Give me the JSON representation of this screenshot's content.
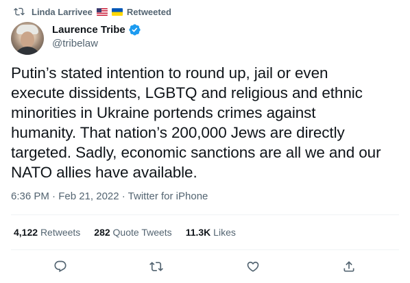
{
  "context": {
    "icon": "retweet-icon",
    "retweeter": "Linda Larrivee",
    "flags": [
      "flag-us",
      "flag-ukraine"
    ],
    "label": "Retweeted"
  },
  "author": {
    "display_name": "Laurence Tribe",
    "verified": true,
    "handle": "@tribelaw"
  },
  "tweet": {
    "text": "Putin’s stated intention to round up, jail or even\nexecute dissidents, LGBTQ and religious and ethnic\nminorities in Ukraine portends crimes against\nhumanity. That nation’s 200,000 Jews are directly\ntargeted. Sadly, economic sanctions are all we and our\nNATO allies have available.",
    "time": "6:36 PM · Feb 21, 2022 · Twitter for iPhone"
  },
  "stats": {
    "retweets": {
      "count": "4,122",
      "label": "Retweets"
    },
    "quote_tweets": {
      "count": "282",
      "label": "Quote Tweets"
    },
    "likes": {
      "count": "11.3K",
      "label": "Likes"
    }
  },
  "actions": [
    "reply-icon",
    "retweet-icon",
    "like-icon",
    "share-icon"
  ],
  "colors": {
    "text": "#0f1419",
    "secondary": "#536471",
    "verified": "#1d9bf0",
    "divider": "#eff3f4"
  }
}
